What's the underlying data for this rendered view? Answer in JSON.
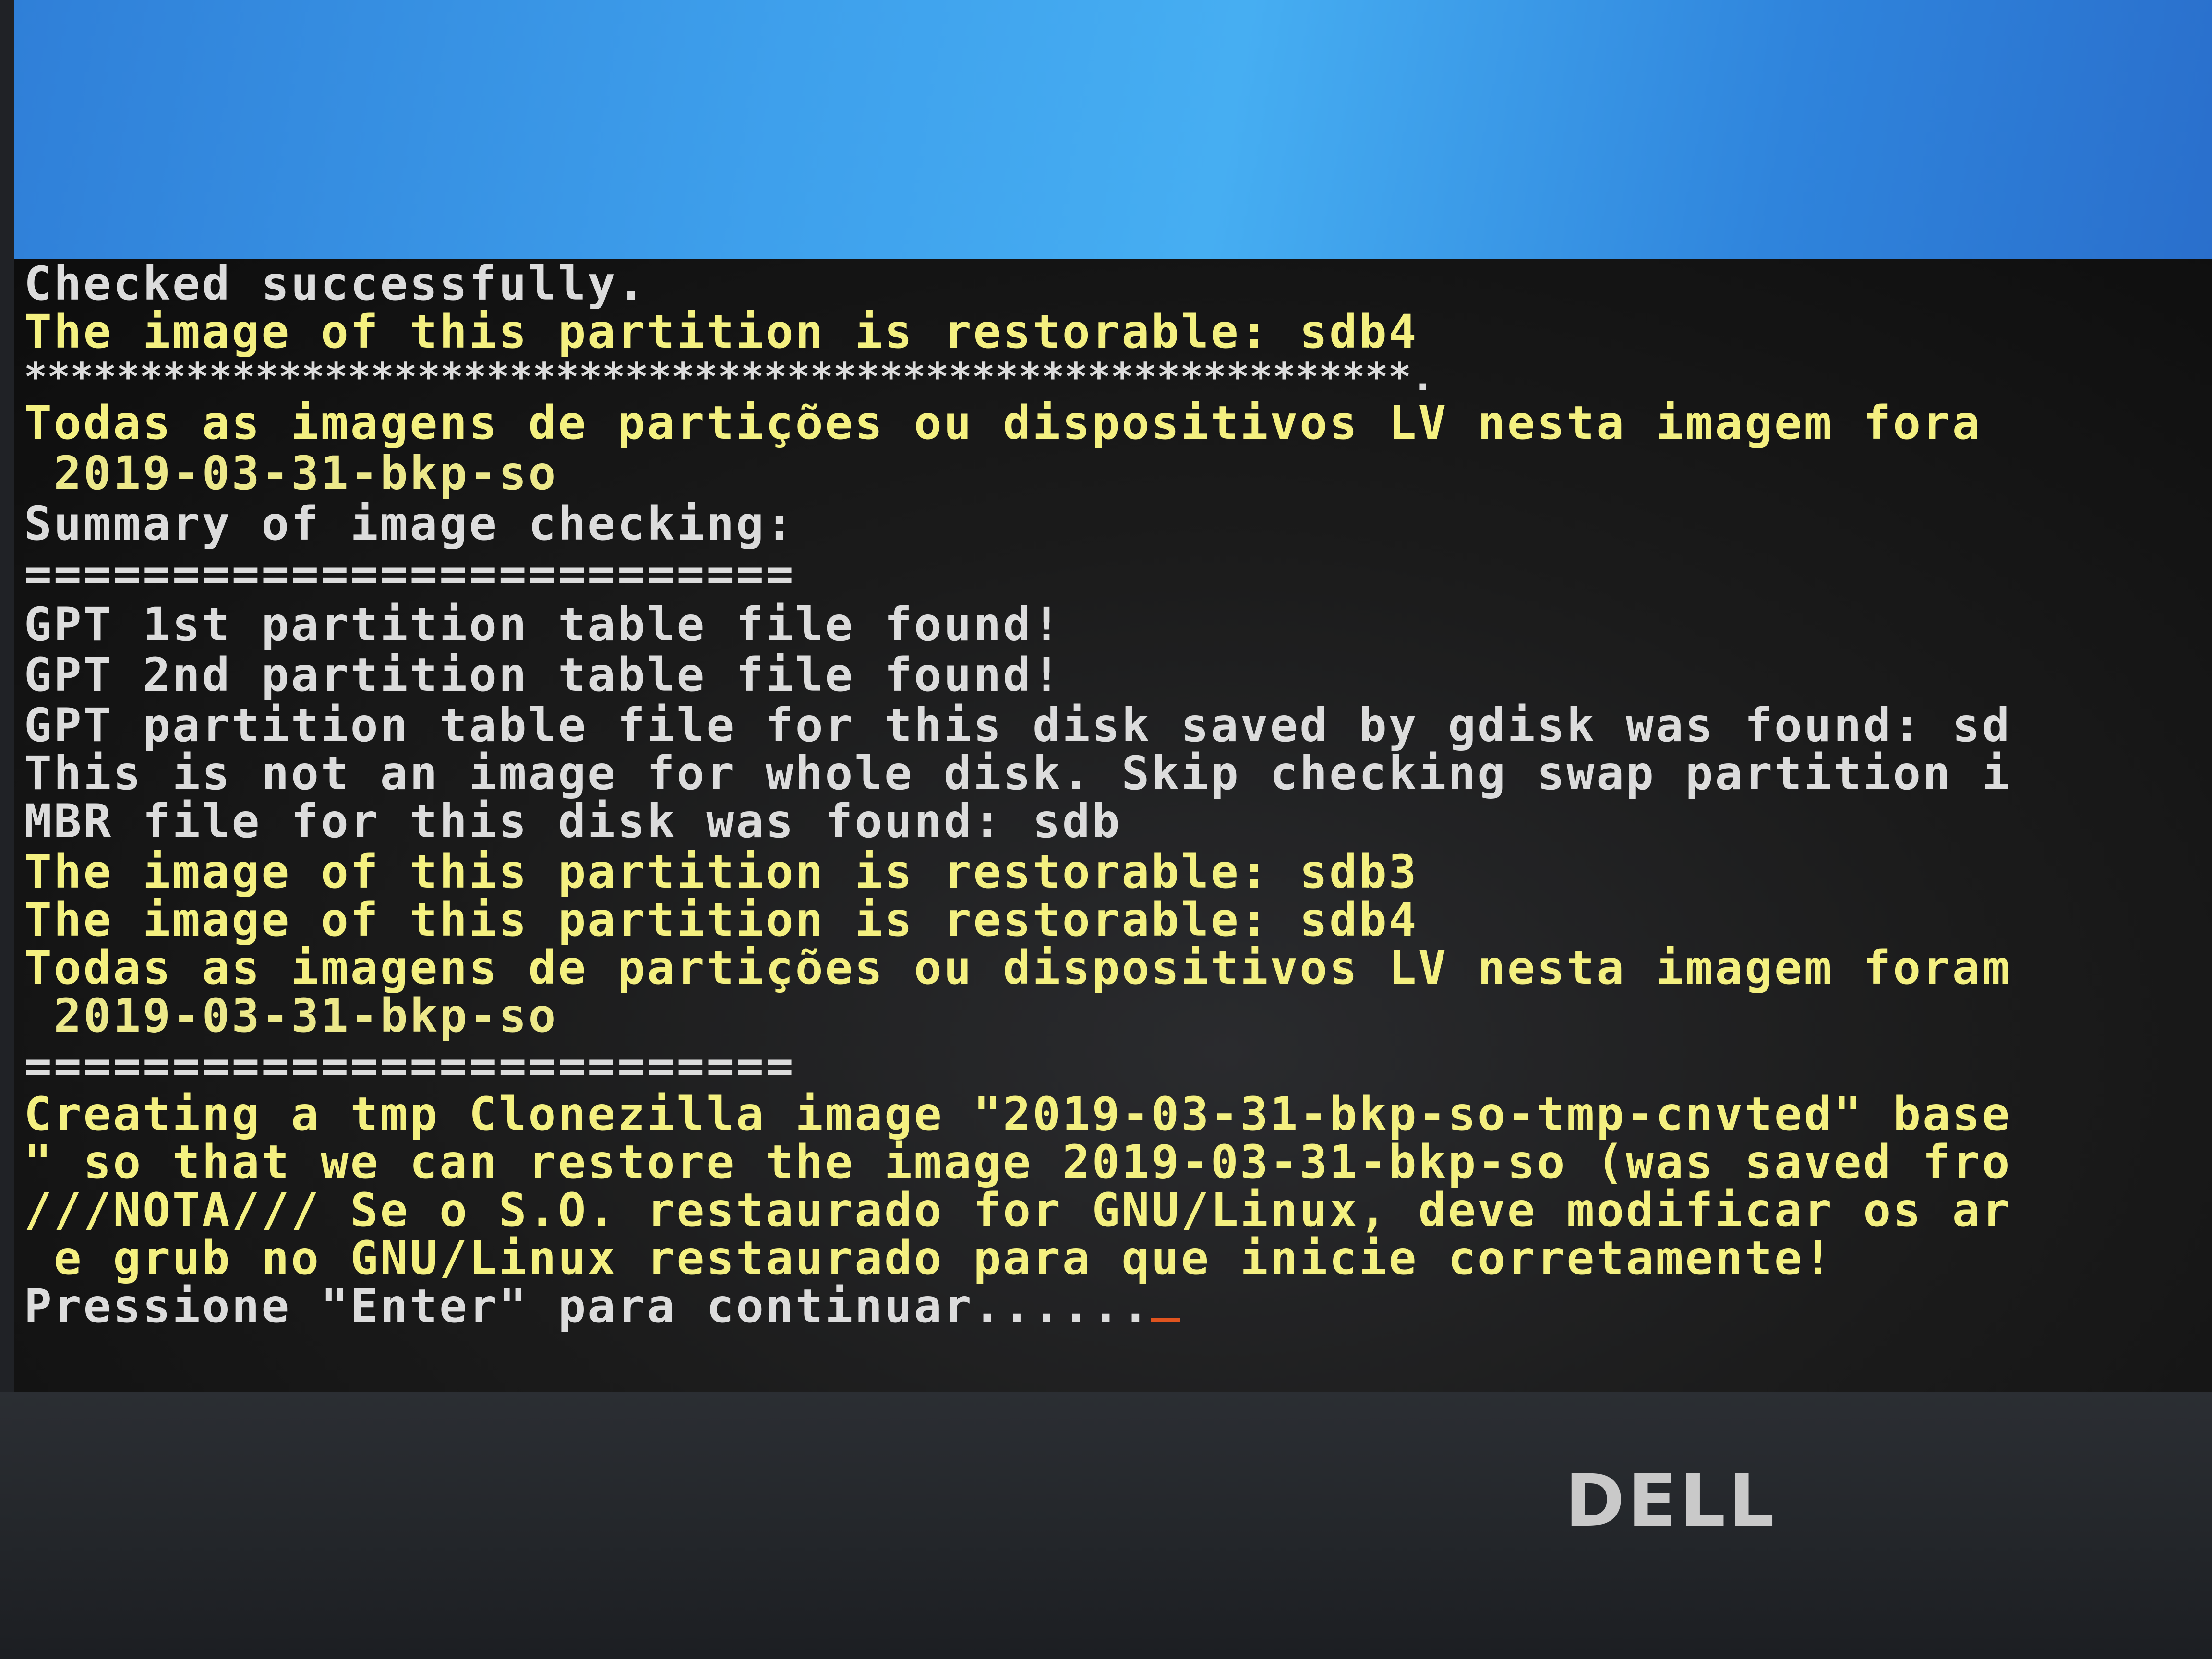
{
  "terminal": {
    "lines": [
      "Checked successfully.",
      "The image of this partition is restorable: sdb4",
      "************************************************************.",
      "Todas as imagens de partições ou dispositivos LV nesta imagem fora",
      " 2019-03-31-bkp-so",
      "Summary of image checking:",
      "==========================",
      "GPT 1st partition table file found!",
      "GPT 2nd partition table file found!",
      "GPT partition table file for this disk saved by gdisk was found: sd",
      "This is not an image for whole disk. Skip checking swap partition i",
      "MBR file for this disk was found: sdb",
      "The image of this partition is restorable: sdb3",
      "The image of this partition is restorable: sdb4",
      "Todas as imagens de partições ou dispositivos LV nesta imagem foram",
      " 2019-03-31-bkp-so",
      "==========================",
      "Creating a tmp Clonezilla image \"2019-03-31-bkp-so-tmp-cnvted\" base",
      "\" so that we can restore the image 2019-03-31-bkp-so (was saved fro",
      "///NOTA/// Se o S.O. restaurado for GNU/Linux, deve modificar os ar",
      " e grub no GNU/Linux restaurado para que inicie corretamente!",
      "Pressione \"Enter\" para continuar......"
    ]
  },
  "brand": {
    "logo_text": "DELL"
  },
  "colors": {
    "text_white": "#dcdcdc",
    "text_yellow": "#f4f080",
    "cursor": "#e0541f",
    "desktop_blue": "#3ea0ec",
    "terminal_bg": "#1b1b1b"
  }
}
